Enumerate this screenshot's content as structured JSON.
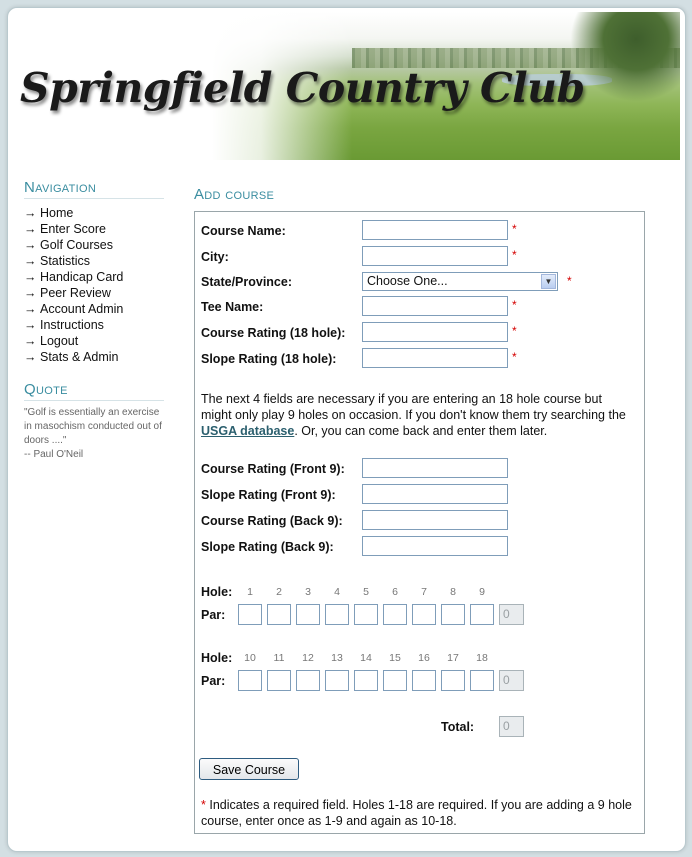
{
  "header": {
    "title": "Springfield Country Club"
  },
  "sidebar": {
    "nav_title": "Navigation",
    "items": [
      {
        "label": "Home"
      },
      {
        "label": "Enter Score"
      },
      {
        "label": "Golf Courses"
      },
      {
        "label": "Statistics"
      },
      {
        "label": "Handicap Card"
      },
      {
        "label": "Peer Review"
      },
      {
        "label": "Account Admin"
      },
      {
        "label": "Instructions"
      },
      {
        "label": "Logout"
      },
      {
        "label": "Stats & Admin"
      }
    ],
    "arrow": "→",
    "quote_title": "Quote",
    "quote_text": "\"Golf is essentially an exercise in masochism conducted out of doors ....\"",
    "quote_author": "-- Paul O'Neil"
  },
  "form": {
    "title": "Add course",
    "required_mark": "*",
    "fields": {
      "course_name": "Course Name:",
      "city": "City:",
      "state": "State/Province:",
      "tee_name": "Tee Name:",
      "course_rating_18": "Course Rating (18 hole):",
      "slope_rating_18": "Slope Rating (18 hole):",
      "course_rating_front": "Course Rating (Front 9):",
      "slope_rating_front": "Slope Rating (Front 9):",
      "course_rating_back": "Course Rating (Back 9):",
      "slope_rating_back": "Slope Rating (Back 9):"
    },
    "state_selected": "Choose One...",
    "info_before": "The next 4 fields are necessary if you are entering an 18 hole course but might only play 9 holes on occasion. If you don't know them try searching the ",
    "info_link": "USGA database",
    "info_after": ". Or, you can come back and enter them later.",
    "hole_label": "Hole:",
    "par_label": "Par:",
    "front_holes": [
      "1",
      "2",
      "3",
      "4",
      "5",
      "6",
      "7",
      "8",
      "9"
    ],
    "back_holes": [
      "10",
      "11",
      "12",
      "13",
      "14",
      "15",
      "16",
      "17",
      "18"
    ],
    "front_sum": "0",
    "back_sum": "0",
    "total_label": "Total:",
    "total_value": "0",
    "save_label": "Save Course",
    "note_star": "*",
    "note_text": " Indicates a required field. Holes 1-18 are required. If you are adding a 9 hole course, enter once as 1-9 and again as 10-18."
  }
}
